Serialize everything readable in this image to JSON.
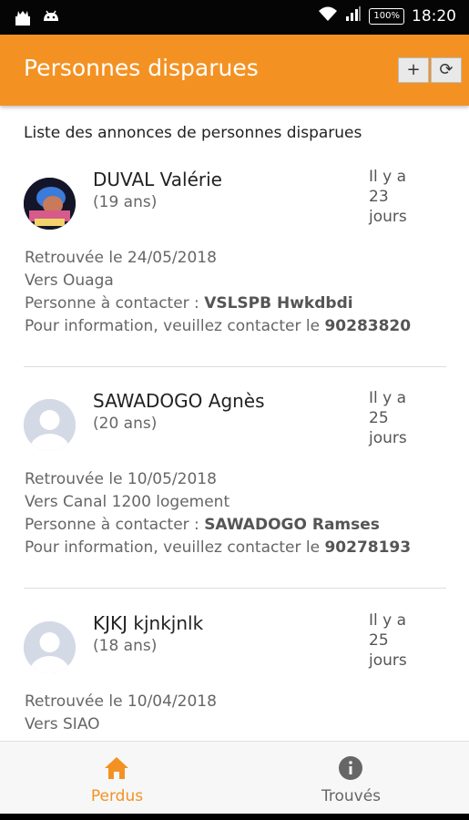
{
  "status_bar": {
    "battery": "100%",
    "time": "18:20"
  },
  "app_bar": {
    "title": "Personnes disparues",
    "add_label": "+",
    "refresh_label": "⟳"
  },
  "list": {
    "title": "Liste des annonces de personnes disparues",
    "contact_prefix": "Personne à contacter : ",
    "info_prefix": "Pour information, veuillez contacter le ",
    "items": [
      {
        "name": "DUVAL Valérie",
        "age": "(19 ans)",
        "ago_1": "Il y a",
        "ago_2": "23",
        "ago_3": "jours",
        "found": "Retrouvée le 24/05/2018",
        "place": "Vers Ouaga",
        "contact": "VSLSPB Hwkdbdi",
        "phone": "90283820",
        "avatar": "photo"
      },
      {
        "name": "SAWADOGO Agnès",
        "age": "(20 ans)",
        "ago_1": "Il y a",
        "ago_2": "25",
        "ago_3": "jours",
        "found": "Retrouvée le 10/05/2018",
        "place": "Vers Canal 1200 logement",
        "contact": "SAWADOGO Ramses",
        "phone": "90278193",
        "avatar": "person-placeholder-icon"
      },
      {
        "name": "KJKJ kjnkjnlk",
        "age": "(18 ans)",
        "ago_1": "Il y a",
        "ago_2": "25",
        "ago_3": "jours",
        "found": "Retrouvée le 10/04/2018",
        "place": "Vers SIAO",
        "avatar": "person-placeholder-icon"
      }
    ]
  },
  "bottom_nav": {
    "tabs": [
      {
        "label": "Perdus",
        "icon": "home-icon",
        "active": true
      },
      {
        "label": "Trouvés",
        "icon": "info-icon",
        "active": false
      }
    ]
  },
  "colors": {
    "accent": "#f39223",
    "inactive_tab": "#666666",
    "placeholder_avatar": "#d4d9e6"
  }
}
